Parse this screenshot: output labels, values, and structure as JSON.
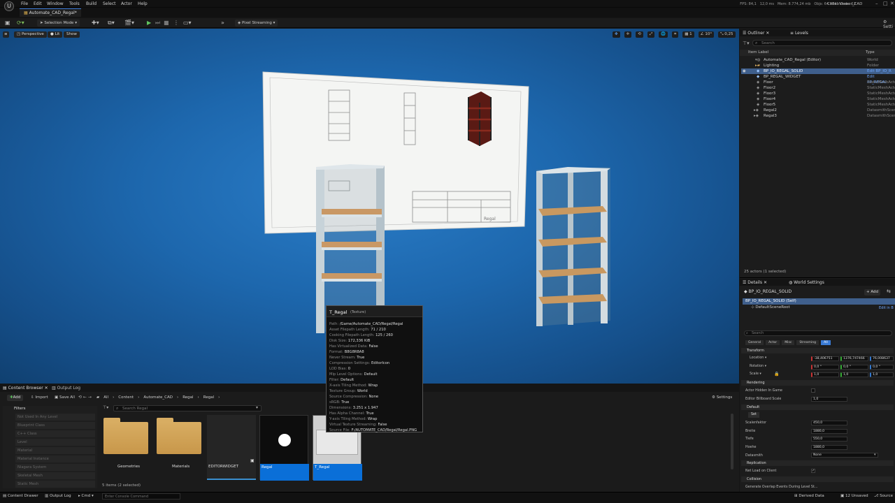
{
  "app": {
    "logo": "U",
    "project": "CollabViewer_CAD"
  },
  "menubar": [
    "File",
    "Edit",
    "Window",
    "Tools",
    "Build",
    "Select",
    "Actor",
    "Help"
  ],
  "document_tab": "Automate_CAD_Regal*",
  "stats": [
    "FPS: 84,1",
    "12,0 ms",
    "Mem: 8.774,24 mb",
    "Objs: 64.884",
    "Undo: 12"
  ],
  "toolbar": {
    "selection_mode": "Selection Mode",
    "pixel_streaming": "Pixel Streaming"
  },
  "viewport": {
    "perspective": "Perspective",
    "lit": "Lit",
    "show": "Show",
    "snap_angle": "10°",
    "camera_speed": "0,25",
    "grid": "2",
    "count": "1",
    "drawing_label": "Regal"
  },
  "outliner": {
    "tab": "Outliner",
    "levels_tab": "Levels",
    "search_placeholder": "Search",
    "col_label": "Item Label",
    "col_type": "Type",
    "items": [
      {
        "label": "Automate_CAD_Regal (Editor)",
        "type": "World"
      },
      {
        "label": "Lighting",
        "type": "Folder"
      },
      {
        "label": "BP_IO_REGAL_SOLID",
        "type": "Edit BP_IO_R"
      },
      {
        "label": "BP_REGAL_WIDGET",
        "type": "Edit BP_REGAL"
      },
      {
        "label": "Floor",
        "type": "StaticMeshActo"
      },
      {
        "label": "Floor2",
        "type": "StaticMeshActo"
      },
      {
        "label": "Floor3",
        "type": "StaticMeshActo"
      },
      {
        "label": "Floor4",
        "type": "StaticMeshActo"
      },
      {
        "label": "Floor5",
        "type": "StaticMeshActo"
      },
      {
        "label": "Regal2",
        "type": "DatasmithScen"
      },
      {
        "label": "Regal3",
        "type": "DatasmithScen"
      }
    ],
    "footer": "25 actors (1 selected)"
  },
  "details": {
    "tab": "Details",
    "world_settings_tab": "World Settings",
    "selected_actor": "BP_IO_REGAL_SOLID",
    "add_label": "+ Add",
    "self_component": "BP_IO_REGAL_SOLID (Self)",
    "root_component": "DefaultSceneRoot",
    "edit_in_bp": "Edit in B",
    "search_placeholder": "Search",
    "filter_tabs": [
      "General",
      "Actor",
      "Misc",
      "Streaming",
      "All"
    ],
    "transform_header": "Transform",
    "location_label": "Location",
    "rotation_label": "Rotation",
    "scale_label": "Scale",
    "location": [
      "-38,406751",
      "1376,747466",
      "76,008637"
    ],
    "rotation": [
      "0,0 °",
      "0,0 °",
      "0,0 °"
    ],
    "scale": [
      "1,0",
      "1,0",
      "1,0"
    ],
    "rendering_header": "Rendering",
    "actor_hidden_label": "Actor Hidden In Game",
    "billboard_label": "Editor Billboard Scale",
    "billboard_value": "1,0",
    "default_header": "Default",
    "set_button": "Set",
    "scale_factor_label": "Scalenfaktor",
    "scale_factor": "450,0",
    "breite_label": "Breite",
    "breite": "1880,0",
    "tiefe_label": "Tiefe",
    "tiefe": "550,0",
    "hoehe_label": "Hoehe",
    "hoehe": "1880,0",
    "datasmith_label": "Datasmith",
    "datasmith_value": "None",
    "replication_header": "Replication",
    "net_load_label": "Net Load on Client",
    "collision_header": "Collision",
    "overlap_label": "Generate Overlap Events During Level St..."
  },
  "content_browser": {
    "tab": "Content Browser",
    "output_log_tab": "Output Log",
    "add": "Add",
    "import": "Import",
    "save_all": "Save All",
    "path": [
      "All",
      "Content",
      "Automate_CAD",
      "Regal",
      "Regal"
    ],
    "settings": "Settings",
    "search_placeholder": "Search Regal",
    "filters_title": "Filters",
    "filters": [
      "Not Used In Any Level",
      "Blueprint Class",
      "C++ Class",
      "Level",
      "Material",
      "Material Instance",
      "Niagara System",
      "Skeletal Mesh",
      "Static Mesh"
    ],
    "assets": [
      {
        "name": "Geometries",
        "kind": "folder"
      },
      {
        "name": "Materials",
        "kind": "folder"
      },
      {
        "name": "EDITORWIDGET",
        "kind": "widget"
      },
      {
        "name": "Regal",
        "kind": "mesh"
      },
      {
        "name": "T_Regal",
        "kind": "texture"
      }
    ],
    "footer": "5 items (2 selected)"
  },
  "tooltip": {
    "title": "T_Regal",
    "subtitle": "(Texture)",
    "lines": [
      {
        "k": "Path:",
        "v": "/Game/Automate_CAD/Regal/Regal"
      },
      {
        "k": "Asset Filepath Length:",
        "v": "71 / 210"
      },
      {
        "k": "Cooking Filepath Length:",
        "v": "125 / 260"
      },
      {
        "k": "Disk Size:",
        "v": "172,336 KiB"
      },
      {
        "k": "Has Virtualized Data:",
        "v": "False"
      },
      {
        "k": "Format:",
        "v": "B8G8R8A8"
      },
      {
        "k": "Never Stream:",
        "v": "True"
      },
      {
        "k": "Compression Settings:",
        "v": "EditorIcon"
      },
      {
        "k": "LOD Bias:",
        "v": "0"
      },
      {
        "k": "Mip Level Options:",
        "v": "Default"
      },
      {
        "k": "Filter:",
        "v": "Default"
      },
      {
        "k": "X-axis Tiling Method:",
        "v": "Wrap"
      },
      {
        "k": "Texture Group:",
        "v": "World"
      },
      {
        "k": "Source Compression:",
        "v": "None"
      },
      {
        "k": "sRGB:",
        "v": "True"
      },
      {
        "k": "Dimensions:",
        "v": "3.251 x 1.947"
      },
      {
        "k": "Has Alpha Channel:",
        "v": "True"
      },
      {
        "k": "Y-axis Tiling Method:",
        "v": "Wrap"
      },
      {
        "k": "Virtual Texture Streaming:",
        "v": "False"
      },
      {
        "k": "Source File:",
        "v": "F:/AUTOMATE_CAD/Regal/Regal.PNG"
      }
    ]
  },
  "statusbar": {
    "content_drawer": "Content Drawer",
    "output_log": "Output Log",
    "cmd": "Cmd",
    "console_placeholder": "Enter Console Command",
    "derived_data": "Derived Data",
    "unsaved": "12 Unsaved",
    "source": "Source"
  }
}
